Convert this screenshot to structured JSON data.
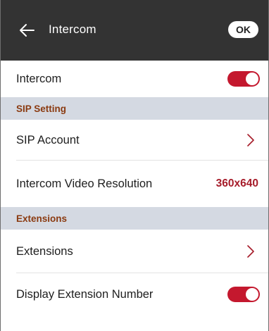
{
  "header": {
    "title": "Intercom",
    "ok_label": "OK",
    "back_icon": "arrow-left-icon"
  },
  "rows": {
    "intercom": {
      "label": "Intercom",
      "enabled": true
    },
    "sip_section": "SIP Setting",
    "sip_account": {
      "label": "SIP Account",
      "icon": "chevron-right-icon"
    },
    "video_resolution": {
      "label": "Intercom Video Resolution",
      "value": "360x640"
    },
    "extensions_section": "Extensions",
    "extensions": {
      "label": "Extensions",
      "icon": "chevron-right-icon"
    },
    "display_extension_number": {
      "label": "Display Extension Number",
      "enabled": true
    }
  },
  "colors": {
    "header_bg": "#333333",
    "toggle_on": "#c4182e",
    "section_bg": "#d4d9e2",
    "section_text": "#8a3a10",
    "value_text": "#a61c2a"
  }
}
